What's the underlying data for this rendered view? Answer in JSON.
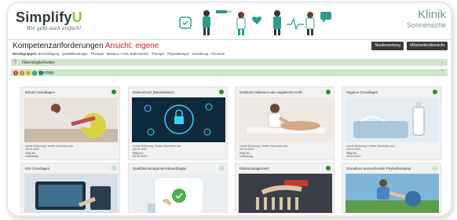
{
  "header": {
    "logo_main": "Simplify",
    "logo_accent": "U",
    "logo_tagline": "Wir geht auch einfach!",
    "klinik_name": "Klinik",
    "klinik_sub": "Sonnensche"
  },
  "title": {
    "prefix": "Kompetenzanforderungen ",
    "accent": "Ansicht: eigene"
  },
  "buttons": {
    "new": "Neubewertung",
    "overview": "Mitarbeiterübersicht"
  },
  "groups": {
    "label": "Berufsgruppen:",
    "list": "Beschäftigung · Qualitätsmanager · Therapie · Masseur / med. Bademeister · Therapie · Physiotherapie · Verwaltung · Personal"
  },
  "categories": [
    {
      "label": "Filtermöglichkeiten"
    },
    {
      "label": "Benötigt",
      "dots": [
        "5",
        "0",
        "2",
        "2",
        ""
      ]
    }
  ],
  "cards": [
    {
      "title": "Bobath Grundlagen",
      "status": "done",
      "meta": [
        "Letzte Schulung / letzter Nachweis am:",
        "28.04.2020",
        "fällig bis:",
        "vollständig"
      ]
    },
    {
      "title": "Datenschutz (Basiswissen)",
      "status": "done",
      "meta": [
        "Letzte Schulung / letzter Nachweis am:",
        "06.09.2020",
        "fällig bis:",
        "06.09.2023"
      ]
    },
    {
      "title": "Geleiteter Masseur oder angelernte Kraft",
      "status": "done",
      "meta": [
        "Letzte Schulung / letzter Nachweis am:",
        "28.04.2018",
        "fällig bis:",
        "vollständig"
      ]
    },
    {
      "title": "Hygiene Grundlagen",
      "status": "done",
      "meta": [
        "Letzte Schulung / letzter Nachweis am:",
        "28.04.2020",
        "fällig bis:",
        "28.04.2023"
      ]
    },
    {
      "title": "KIS Grundlagen",
      "status": "light"
    },
    {
      "title": "Qualitätsmanagement-Beauftragter",
      "status": "light"
    },
    {
      "title": "Risikomanagement",
      "status": "done"
    },
    {
      "title": "Grundkurs ausreichender Physiotherapeut",
      "status": "light"
    }
  ]
}
